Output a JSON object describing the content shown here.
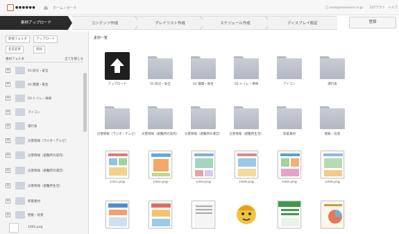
{
  "topbar": {
    "logo_text": "●●●●●●",
    "crumb": "ホーム / ボード",
    "user": "〇 xxxx@xxxxxxxx.co.jp",
    "logout": "ログアウト",
    "help": "ヘルプ"
  },
  "steps": {
    "items": [
      {
        "label": "素材アップロード",
        "active": true
      },
      {
        "label": "コンテンツ作成",
        "active": false
      },
      {
        "label": "プレイリスト作成",
        "active": false
      },
      {
        "label": "スケジュール作成",
        "active": false
      },
      {
        "label": "ディスプレイ設定",
        "active": false
      }
    ],
    "save_label": "登録"
  },
  "sidebar": {
    "btn_new_folder": "新規フォルダ",
    "btn_upload": "アップロード",
    "btn_rename": "名前変更",
    "btn_delete": "削除",
    "tree_head": "素材フォルダ",
    "tree_head_right": "全てを閉じる",
    "items": [
      {
        "label": "01.防災・安全"
      },
      {
        "label": "02.健康・衛生"
      },
      {
        "label": "03.トイレ・清掃"
      },
      {
        "label": "アイコン"
      },
      {
        "label": "運行表"
      },
      {
        "label": "災害情報（ラジオ・テレビ）"
      },
      {
        "label": "災害情報（避難所の案内）"
      },
      {
        "label": "災害情報（避難所の運営）"
      },
      {
        "label": "災害情報（避難所生活）"
      },
      {
        "label": "新着素材"
      },
      {
        "label": "壁紙・背景"
      },
      {
        "label": "1002.png"
      }
    ]
  },
  "main": {
    "title": "素材一覧",
    "row1": [
      "アップロード",
      "01.防災・安全",
      "02.健康・衛生",
      "03.トイレ・清掃",
      "アイコン",
      "運行表"
    ],
    "row2": [
      "災害情報（ラジオ・テレビ）",
      "災害情報（避難所の案内）",
      "災害情報（避難所の運営）",
      "災害情報（避難所生活）",
      "新着素材",
      "壁紙・背景"
    ],
    "row3": [
      "1001.png",
      "1002.png",
      "1003.png",
      "1004.png",
      "1005.png",
      "1006.png"
    ]
  },
  "colors": {
    "active_step": "#2b2b2b",
    "logo": "#e0601e",
    "folder": "#c1c5cf"
  }
}
